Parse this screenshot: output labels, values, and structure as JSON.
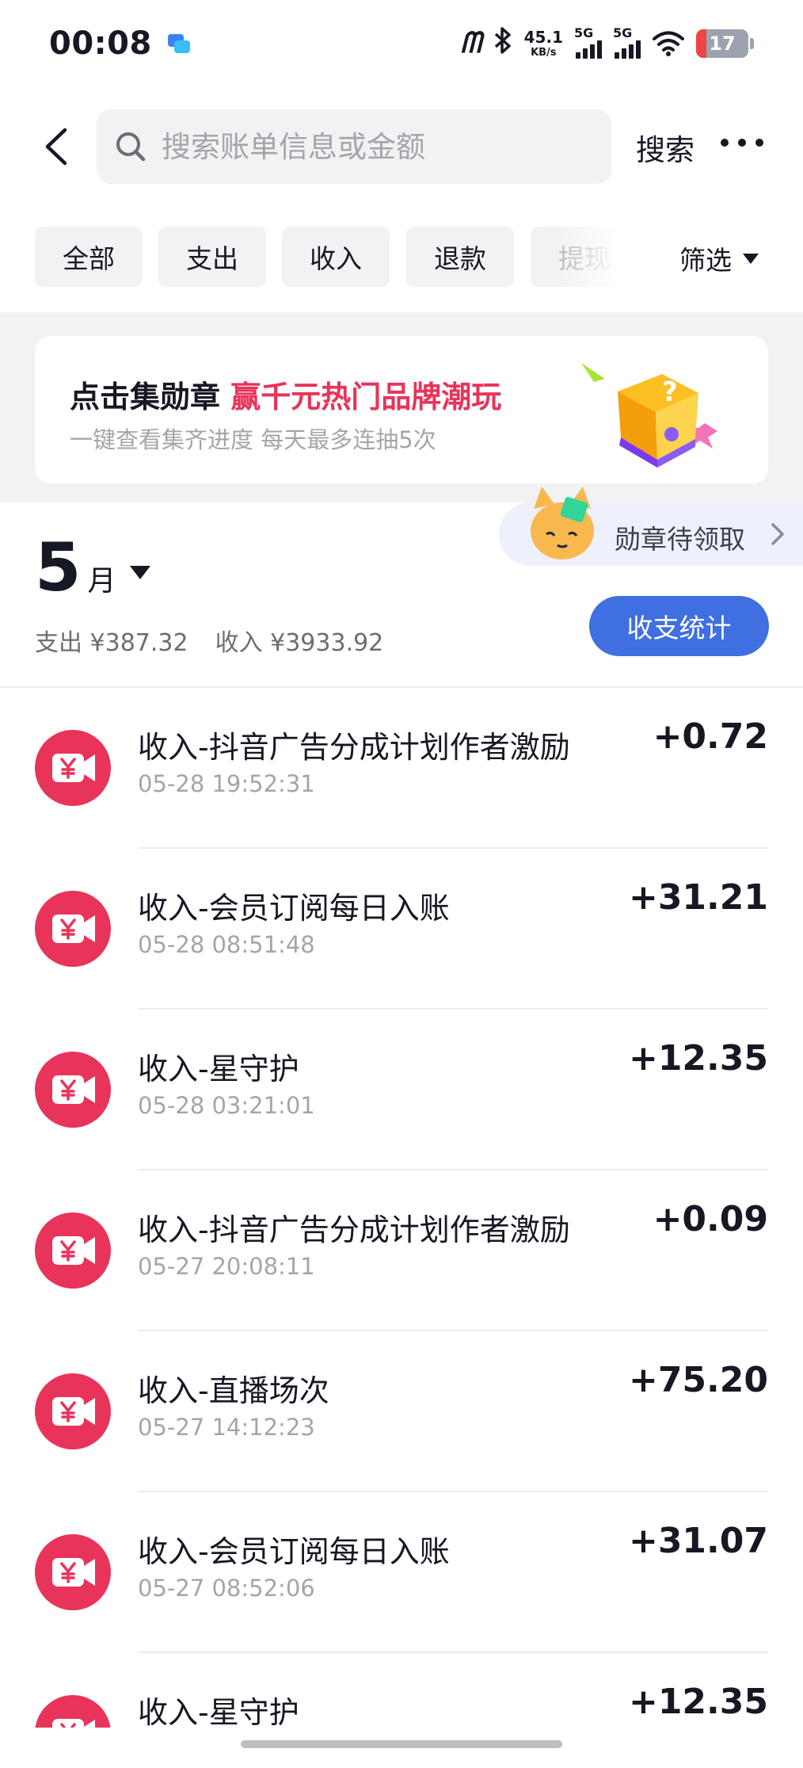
{
  "status_bar": {
    "time": "00:08",
    "net_speed_value": "45.1",
    "net_speed_unit": "KB/s",
    "sim1_label": "5G",
    "sim2_label": "5G",
    "battery": "17",
    "battery_color": "#ef4444"
  },
  "search": {
    "placeholder": "搜索账单信息或金额",
    "button_label": "搜索"
  },
  "filters": {
    "tabs": [
      {
        "label": "全部"
      },
      {
        "label": "支出"
      },
      {
        "label": "收入"
      },
      {
        "label": "退款"
      },
      {
        "label": "提现"
      }
    ],
    "filter_label": "筛选"
  },
  "banner": {
    "title_prefix": "点击集勋章 ",
    "title_highlight": "赢千元热门品牌潮玩",
    "subtitle": "一键查看集齐进度 每天最多连抽5次",
    "accent_color": "#e8345a"
  },
  "medal_pill": {
    "label": "勋章待领取"
  },
  "month": {
    "number": "5",
    "unit": "月",
    "expense": "支出 ¥387.32",
    "income": "收入 ¥3933.92",
    "stats_button": "收支统计",
    "button_color": "#3f6fe0"
  },
  "transactions": [
    {
      "title": "收入-抖音广告分成计划作者激励",
      "time": "05-28 19:52:31",
      "amount": "+0.72"
    },
    {
      "title": "收入-会员订阅每日入账",
      "time": "05-28 08:51:48",
      "amount": "+31.21"
    },
    {
      "title": "收入-星守护",
      "time": "05-28 03:21:01",
      "amount": "+12.35"
    },
    {
      "title": "收入-抖音广告分成计划作者激励",
      "time": "05-27 20:08:11",
      "amount": "+0.09"
    },
    {
      "title": "收入-直播场次",
      "time": "05-27 14:12:23",
      "amount": "+75.20"
    },
    {
      "title": "收入-会员订阅每日入账",
      "time": "05-27 08:52:06",
      "amount": "+31.07"
    },
    {
      "title": "收入-星守护",
      "time": "",
      "amount": "+12.35"
    }
  ],
  "icons": {
    "transaction_icon": "yuan-video-camera-icon",
    "transaction_icon_color": "#e8345a"
  }
}
